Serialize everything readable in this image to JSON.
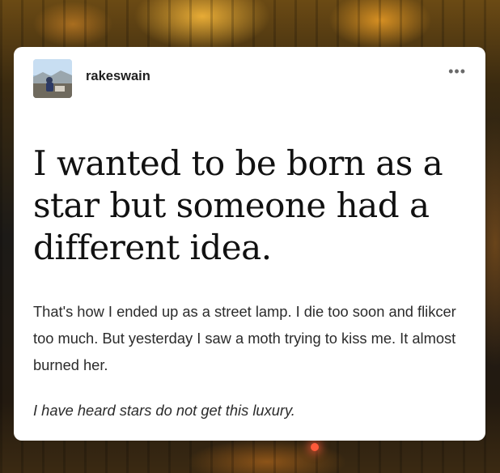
{
  "post": {
    "username": "rakeswain",
    "more_icon": "more-horizontal-icon",
    "avatar": "avatar-photo",
    "headline": "I wanted to be born as a star but someone had a different idea.",
    "body": "That's how I ended up as a street lamp. I die too soon and flikcer too much. But yesterday I saw a moth trying to kiss me. It almost burned her.",
    "italic": "I have heard stars do not get this luxury."
  },
  "colors": {
    "card_background": "#ffffff",
    "headline_text": "#111111",
    "body_text": "#2b2b2b",
    "background_glow": "#ffbe3c"
  }
}
